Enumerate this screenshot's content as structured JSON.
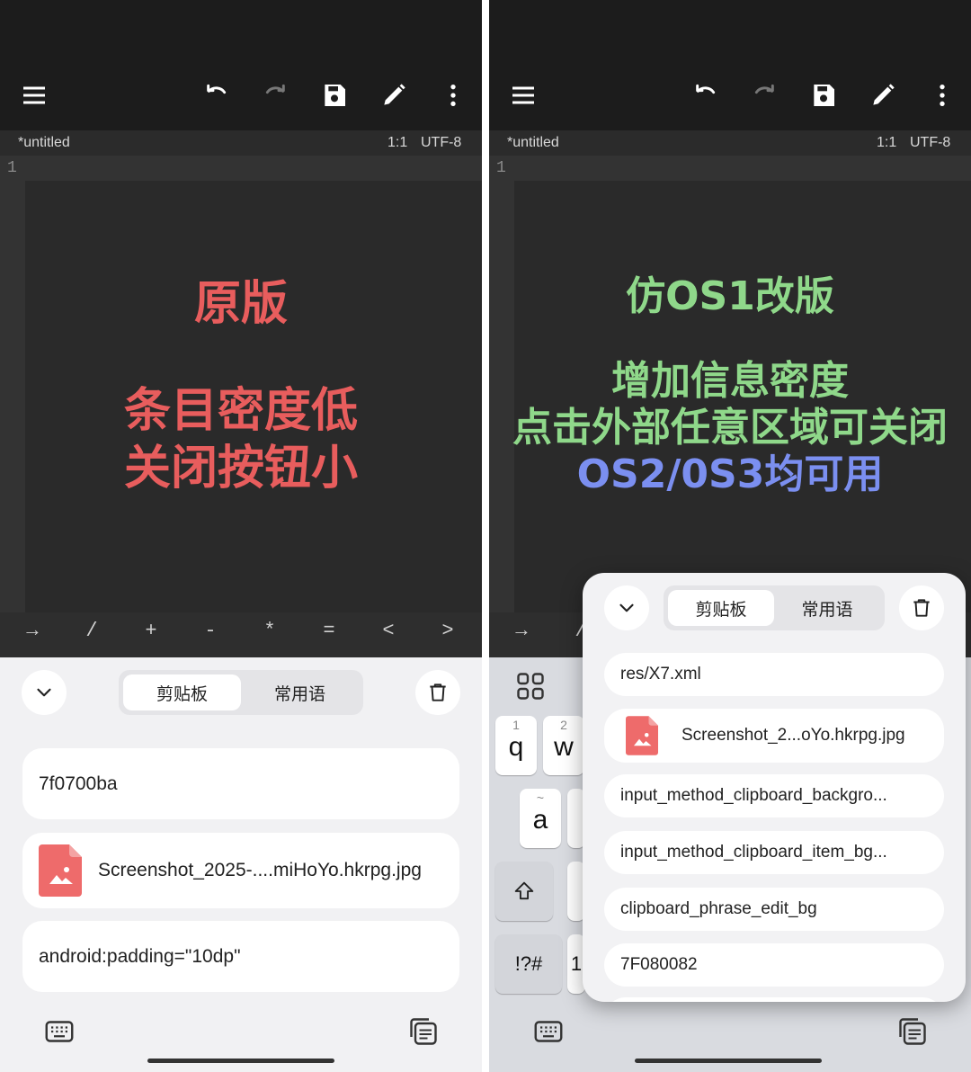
{
  "left": {
    "status": {
      "filename": "*untitled",
      "position": "1:1",
      "encoding": "UTF-8"
    },
    "line_number": "1",
    "annotation": {
      "title": "原版",
      "line1": "条目密度低",
      "line2": "关闭按钮小",
      "color": "#e85d5d"
    },
    "symbols": [
      "→",
      "/",
      "+",
      "-",
      "*",
      "=",
      "<",
      ">"
    ],
    "clipboard": {
      "tabs": {
        "clipboard": "剪贴板",
        "phrases": "常用语"
      },
      "items": [
        {
          "text": "7f0700ba"
        },
        {
          "text": "Screenshot_2025-....miHoYo.hkrpg.jpg"
        },
        {
          "text": "android:padding=\"10dp\""
        }
      ]
    }
  },
  "right": {
    "status": {
      "filename": "*untitled",
      "position": "1:1",
      "encoding": "UTF-8"
    },
    "line_number": "1",
    "annotation": {
      "title": "仿OS1改版",
      "line1": "增加信息密度",
      "line2": "点击外部任意区域可关闭",
      "line3": "OS2/0S3均可用",
      "green": "#8fd88a",
      "blue": "#7b8ff0"
    },
    "symbols": [
      "→",
      "/"
    ],
    "keyboard": {
      "row1": [
        {
          "hint": "1",
          "key": "q"
        },
        {
          "hint": "2",
          "key": "w"
        }
      ],
      "row2": [
        {
          "hint": "~",
          "key": "a"
        }
      ],
      "symbols_key": "!?#",
      "number_key": "1"
    },
    "clipboard": {
      "tabs": {
        "clipboard": "剪贴板",
        "phrases": "常用语"
      },
      "items": [
        {
          "text": "res/X7.xml"
        },
        {
          "text": "Screenshot_2...oYo.hkrpg.jpg"
        },
        {
          "text": "input_method_clipboard_backgro..."
        },
        {
          "text": "input_method_clipboard_item_bg..."
        },
        {
          "text": "clipboard_phrase_edit_bg"
        },
        {
          "text": "7F080082"
        }
      ]
    }
  },
  "colors": {
    "file_icon": "#ee6b6b",
    "dark_bar": "#1c1c1c",
    "editor_bg": "#2a2a2a"
  }
}
